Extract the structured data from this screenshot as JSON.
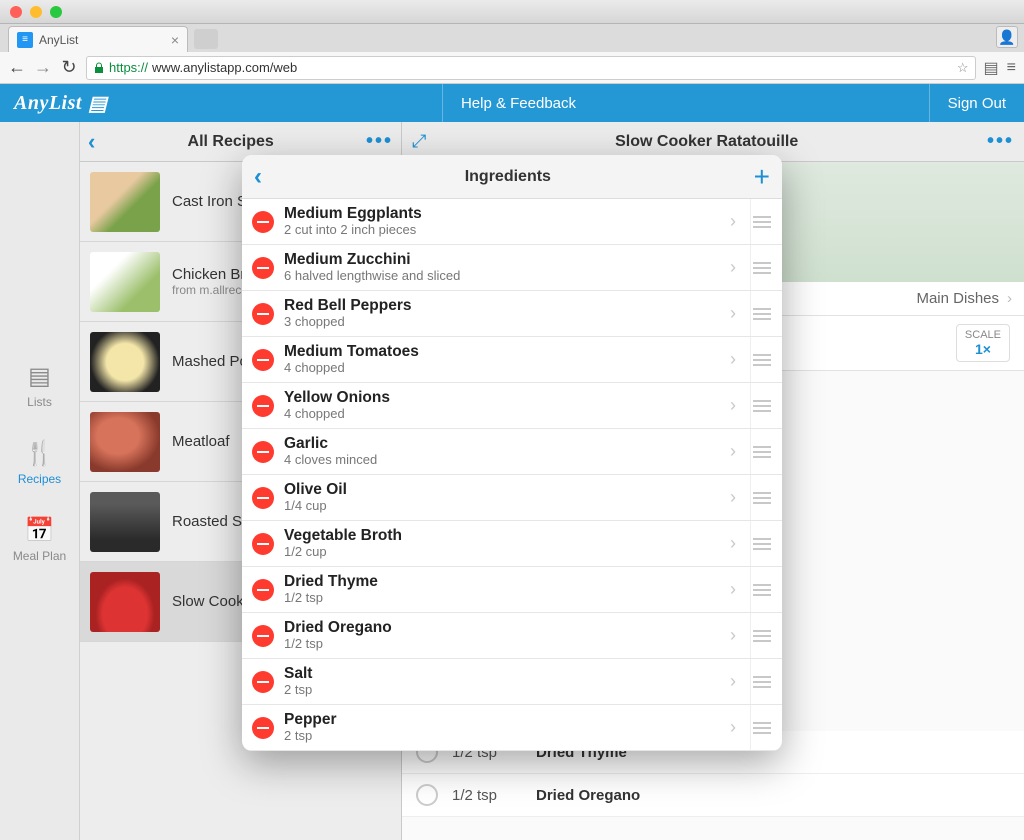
{
  "browser": {
    "tab_title": "AnyList",
    "url_prefix": "https://",
    "url_rest": "www.anylistapp.com/web"
  },
  "header": {
    "logo": "AnyList",
    "help": "Help & Feedback",
    "signout": "Sign Out"
  },
  "sidenav": {
    "lists": "Lists",
    "recipes": "Recipes",
    "mealplan": "Meal Plan"
  },
  "recipes_col": {
    "title": "All Recipes",
    "items": [
      {
        "name": "Cast Iron Skillet Salmon Fillets",
        "sub": ""
      },
      {
        "name": "Chicken Breast",
        "sub": "from m.allrecipes.com"
      },
      {
        "name": "Mashed Potatoes",
        "sub": ""
      },
      {
        "name": "Meatloaf",
        "sub": ""
      },
      {
        "name": "Roasted Sweet Potatoes",
        "sub": ""
      },
      {
        "name": "Slow Cooker Ratatouille",
        "sub": ""
      }
    ]
  },
  "detail": {
    "title": "Slow Cooker Ratatouille",
    "tag": "Main Dishes",
    "scale_label": "SCALE",
    "scale_value": "1×",
    "visible_ingredients": [
      {
        "qty": "1/2 tsp",
        "name": "Dried Thyme"
      },
      {
        "qty": "1/2 tsp",
        "name": "Dried Oregano"
      }
    ]
  },
  "modal": {
    "title": "Ingredients",
    "ingredients": [
      {
        "name": "Medium Eggplants",
        "note": "2 cut into 2 inch pieces"
      },
      {
        "name": "Medium Zucchini",
        "note": "6 halved lengthwise and sliced"
      },
      {
        "name": "Red Bell Peppers",
        "note": "3 chopped"
      },
      {
        "name": "Medium Tomatoes",
        "note": "4 chopped"
      },
      {
        "name": "Yellow Onions",
        "note": "4 chopped"
      },
      {
        "name": "Garlic",
        "note": "4 cloves minced"
      },
      {
        "name": "Olive Oil",
        "note": "1/4 cup"
      },
      {
        "name": "Vegetable Broth",
        "note": "1/2 cup"
      },
      {
        "name": "Dried Thyme",
        "note": "1/2 tsp"
      },
      {
        "name": "Dried Oregano",
        "note": "1/2 tsp"
      },
      {
        "name": "Salt",
        "note": "2 tsp"
      },
      {
        "name": "Pepper",
        "note": "2 tsp"
      }
    ]
  }
}
